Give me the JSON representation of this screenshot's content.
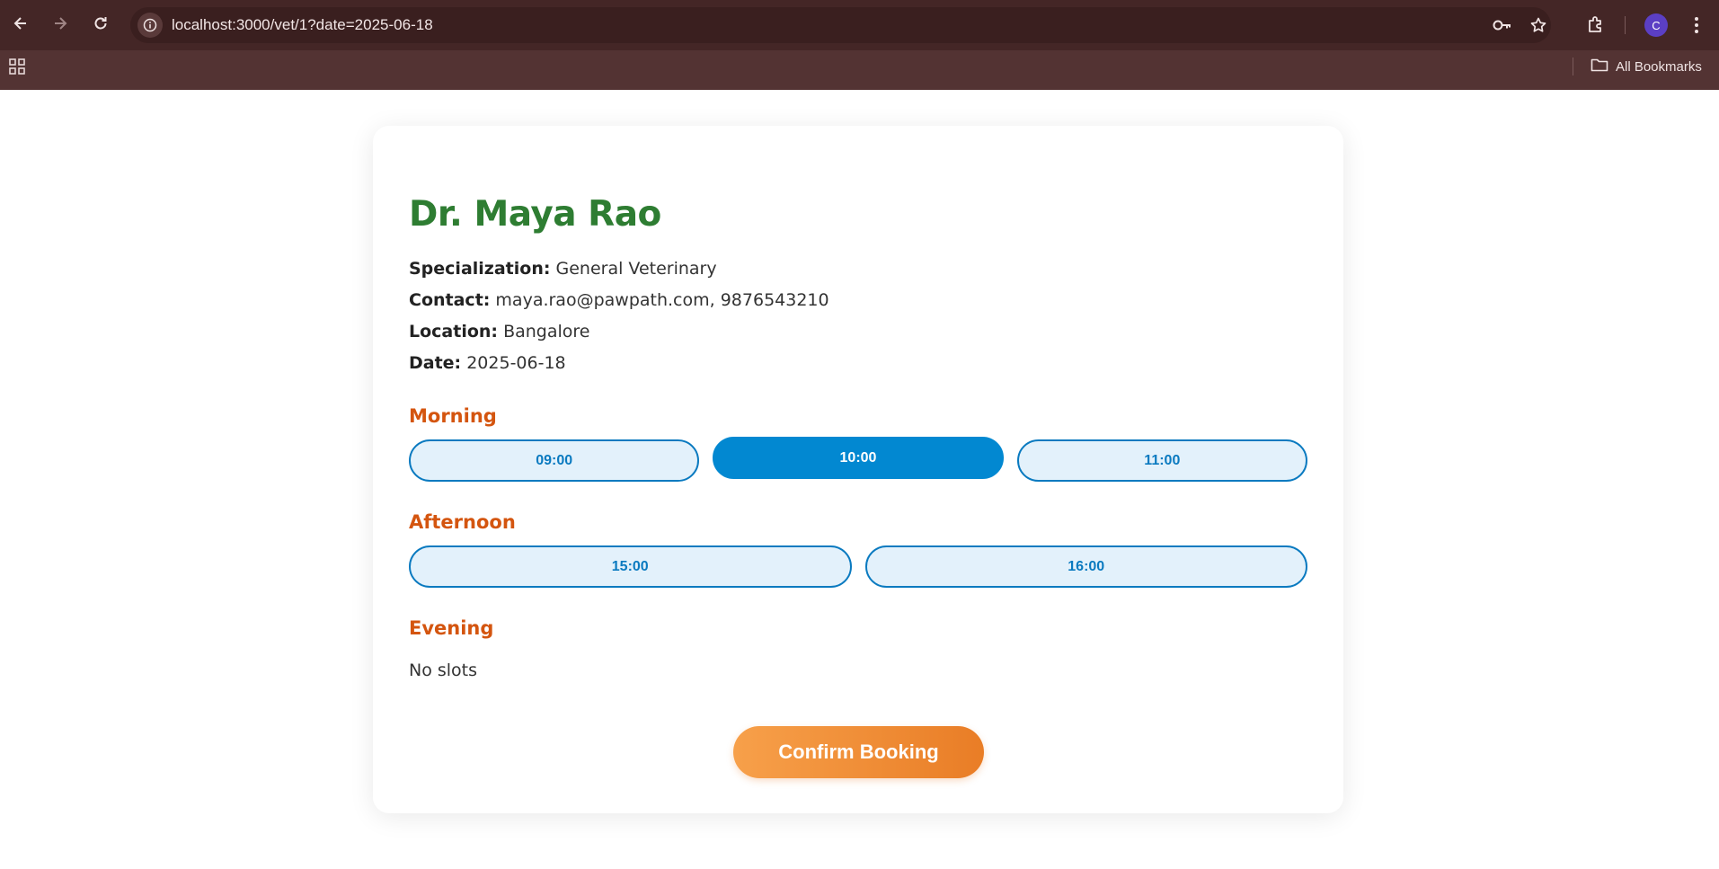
{
  "browser": {
    "url": "localhost:3000/vet/1?date=2025-06-18",
    "avatar_letter": "C",
    "all_bookmarks_label": "All Bookmarks"
  },
  "vet": {
    "name": "Dr. Maya Rao",
    "specialization_label": "Specialization:",
    "specialization": "General Veterinary",
    "contact_label": "Contact:",
    "contact": "maya.rao@pawpath.com, 9876543210",
    "location_label": "Location:",
    "location": "Bangalore",
    "date_label": "Date:",
    "date": "2025-06-18"
  },
  "sections": {
    "morning": {
      "title": "Morning",
      "slots": [
        "09:00",
        "10:00",
        "11:00"
      ],
      "selected": "10:00"
    },
    "afternoon": {
      "title": "Afternoon",
      "slots": [
        "15:00",
        "16:00"
      ]
    },
    "evening": {
      "title": "Evening",
      "empty_text": "No slots"
    }
  },
  "actions": {
    "confirm_label": "Confirm Booking"
  },
  "colors": {
    "name": "#2e7d32",
    "section_title": "#d4550f",
    "slot_accent": "#0288d1",
    "slot_bg": "#e3f1fb",
    "confirm_start": "#f7a04a",
    "confirm_end": "#e97d26",
    "chrome": "#533333"
  }
}
